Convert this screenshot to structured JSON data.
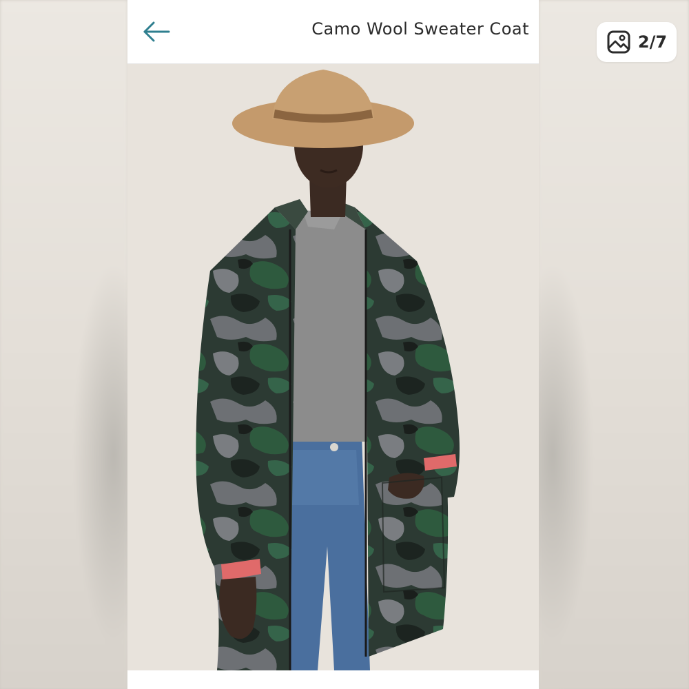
{
  "header": {
    "title": "Camo Wool Sweater Coat",
    "back_icon": "arrow-left-icon"
  },
  "gallery": {
    "counter": "2/7",
    "counter_icon": "image-gallery-icon",
    "current_image": 2,
    "total_images": 7
  },
  "colors": {
    "accent": "#2f7f8f",
    "text": "#2b2b2b",
    "background": "#e6e1da"
  }
}
